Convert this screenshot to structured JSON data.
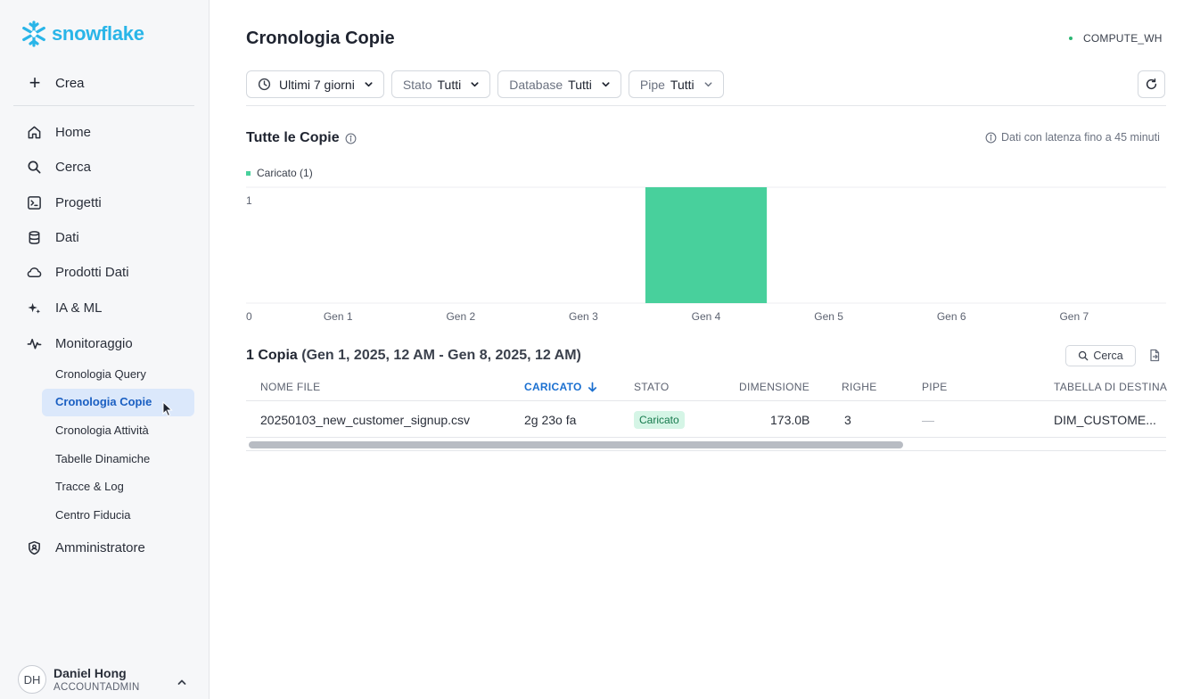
{
  "brand": {
    "name": "snowflake",
    "color": "#29b5e8"
  },
  "sidebar": {
    "create_label": "Crea",
    "items": [
      {
        "label": "Home",
        "icon": "home-icon"
      },
      {
        "label": "Cerca",
        "icon": "search-icon"
      },
      {
        "label": "Progetti",
        "icon": "terminal-icon"
      },
      {
        "label": "Dati",
        "icon": "database-icon"
      },
      {
        "label": "Prodotti Dati",
        "icon": "cloud-icon"
      },
      {
        "label": "IA & ML",
        "icon": "sparkle-icon"
      },
      {
        "label": "Monitoraggio",
        "icon": "activity-icon"
      }
    ],
    "sub_items": [
      {
        "label": "Cronologia Query"
      },
      {
        "label": "Cronologia Copie",
        "active": true
      },
      {
        "label": "Cronologia Attività"
      },
      {
        "label": "Tabelle Dinamiche"
      },
      {
        "label": "Tracce & Log"
      },
      {
        "label": "Centro Fiducia"
      }
    ],
    "admin_label": "Amministratore",
    "user": {
      "initials": "DH",
      "name": "Daniel Hong",
      "role": "ACCOUNTADMIN"
    }
  },
  "header": {
    "title": "Cronologia Copie",
    "warehouse": "COMPUTE_WH",
    "warehouse_status_color": "#2bb673"
  },
  "filters": {
    "time": "Ultimi 7 giorni",
    "stato": {
      "label": "Stato",
      "value": "Tutti"
    },
    "database": {
      "label": "Database",
      "value": "Tutti"
    },
    "pipe": {
      "label": "Pipe",
      "value": "Tutti"
    }
  },
  "chart_section": {
    "title": "Tutte le Copie",
    "latency_note": "Dati con latenza fino a 45 minuti"
  },
  "chart_data": {
    "type": "bar",
    "categories": [
      "Gen 1",
      "Gen 2",
      "Gen 3",
      "Gen 4",
      "Gen 5",
      "Gen 6",
      "Gen 7"
    ],
    "series": [
      {
        "name": "Caricato (1)",
        "values": [
          0,
          0,
          0,
          1,
          0,
          0,
          0
        ],
        "color": "#48d09c"
      }
    ],
    "y_ticks": [
      "0",
      "1"
    ],
    "ylim": [
      0,
      1
    ],
    "grid": true,
    "legend": "top-left"
  },
  "copies": {
    "count_label": "1 Copia",
    "range_label": "(Gen 1, 2025, 12 AM - Gen 8, 2025, 12 AM)",
    "search_label": "Cerca",
    "columns": [
      "NOME FILE",
      "CARICATO",
      "STATO",
      "DIMENSIONE",
      "RIGHE",
      "PIPE",
      "TABELLA DI DESTINA"
    ],
    "rows": [
      {
        "file": "20250103_new_customer_signup.csv",
        "loaded": "2g 23o fa",
        "status": "Caricato",
        "size": "173.0B",
        "rows": "3",
        "pipe": "—",
        "table": "DIM_CUSTOME..."
      }
    ]
  }
}
